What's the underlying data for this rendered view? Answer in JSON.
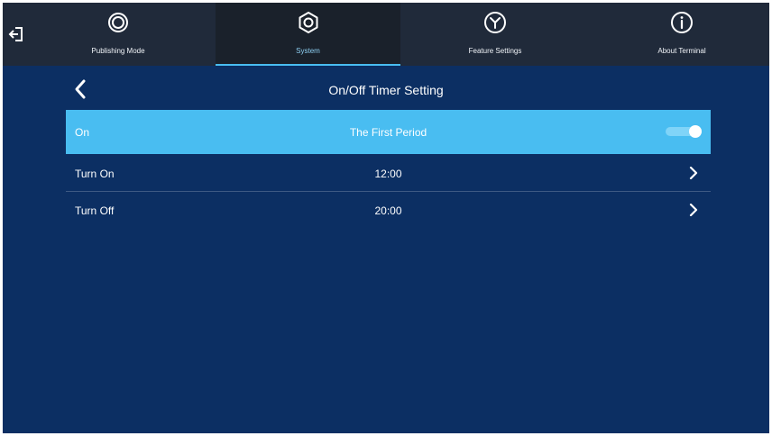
{
  "nav": {
    "tabs": [
      {
        "label": "Publishing Mode",
        "icon": "ring-icon",
        "active": false
      },
      {
        "label": "System",
        "icon": "gear-icon",
        "active": true
      },
      {
        "label": "Feature Settings",
        "icon": "y-circle-icon",
        "active": false
      },
      {
        "label": "About Terminal",
        "icon": "info-icon",
        "active": false
      }
    ],
    "exit_icon": "exit-icon"
  },
  "page": {
    "title": "On/Off Timer Setting",
    "back_icon": "chevron-left-icon"
  },
  "rows": [
    {
      "label": "On",
      "value": "The First Period",
      "control": "toggle",
      "toggle_on": true
    },
    {
      "label": "Turn On",
      "value": "12:00",
      "control": "chevron-right-icon"
    },
    {
      "label": "Turn Off",
      "value": "20:00",
      "control": "chevron-right-icon"
    }
  ],
  "colors": {
    "background": "#0c2f63",
    "topbar": "#202a3a",
    "accent": "#49bdf1",
    "text": "#ffffff"
  }
}
